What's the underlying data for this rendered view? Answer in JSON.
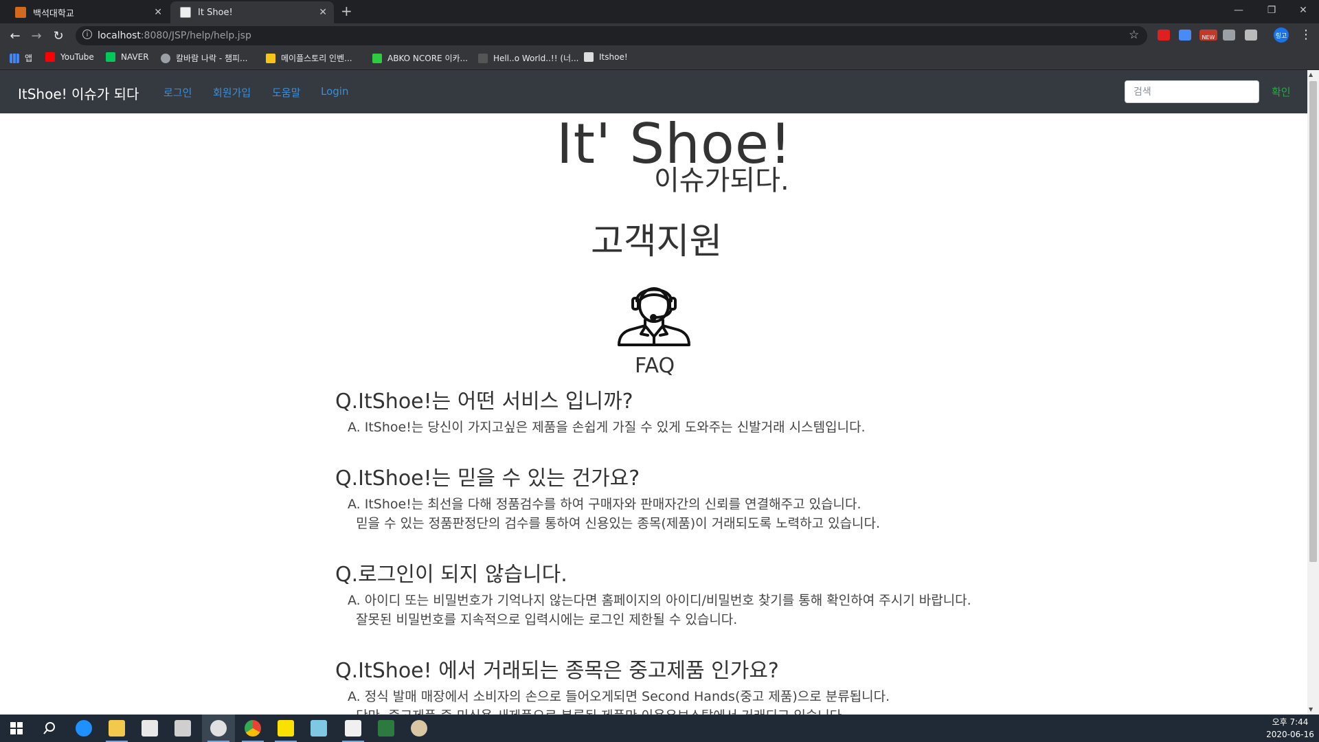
{
  "browser": {
    "tabs": [
      {
        "title": "백석대학교",
        "active": false
      },
      {
        "title": "It Shoe!",
        "active": true
      }
    ],
    "url_host": "localhost",
    "url_rest": ":8080/JSP/help/help.jsp",
    "bookmarks": [
      "앱",
      "YouTube",
      "NAVER",
      "칼바람 나락 - 챔피...",
      "메이플스토리 인벤...",
      "ABKO NCORE 이카...",
      "Hell..o World..!! (너...",
      "Itshoe!"
    ],
    "extension_badge": "NEW",
    "profile_label": "링고"
  },
  "site": {
    "brand": "ItShoe! 이슈가 되다",
    "nav": [
      "로그인",
      "회원가입",
      "도움말",
      "Login"
    ],
    "search_placeholder": "검색",
    "confirm_label": "확인"
  },
  "page": {
    "hero": "It' Shoe!",
    "subhero": "이슈가되다.",
    "section_title": "고객지원",
    "faq_label": "FAQ",
    "faqs": [
      {
        "q": "Q.ItShoe!는 어떤 서비스 입니까?",
        "a": "A. ItShoe!는 당신이 가지고싶은 제품을 손쉽게 가질 수 있게 도와주는 신발거래 시스템입니다."
      },
      {
        "q": "Q.ItShoe!는 믿을 수 있는 건가요?",
        "a": "A. ItShoe!는 최선을 다해 정품검수를 하여 구매자와 판매자간의 신뢰를 연결해주고 있습니다.\n  믿을 수 있는 정품판정단의 검수를 통하여 신용있는 종목(제품)이 거래되도록 노력하고 있습니다."
      },
      {
        "q": "Q.로그인이 되지 않습니다.",
        "a": "A. 아이디 또는 비밀번호가 기억나지 않는다면 홈페이지의 아이디/비밀번호 찾기를 통해 확인하여 주시기 바랍니다.\n  잘못된 비밀번호를 지속적으로 입력시에는 로그인 제한될 수 있습니다."
      },
      {
        "q": "Q.ItShoe! 에서 거래되는 종목은 중고제품 인가요?",
        "a": "A. 정식 발매 매장에서 소비자의 손으로 들어오게되면 Second Hands(중고 제품)으로 분류됩니다.\n  단만, 중고제품 중 미신용 새제품으로 분류된 제품만 이용우보스탑에서 거래되고 있습니다."
      }
    ]
  },
  "taskbar": {
    "time": "오후 7:44",
    "date": "2020-06-16"
  }
}
